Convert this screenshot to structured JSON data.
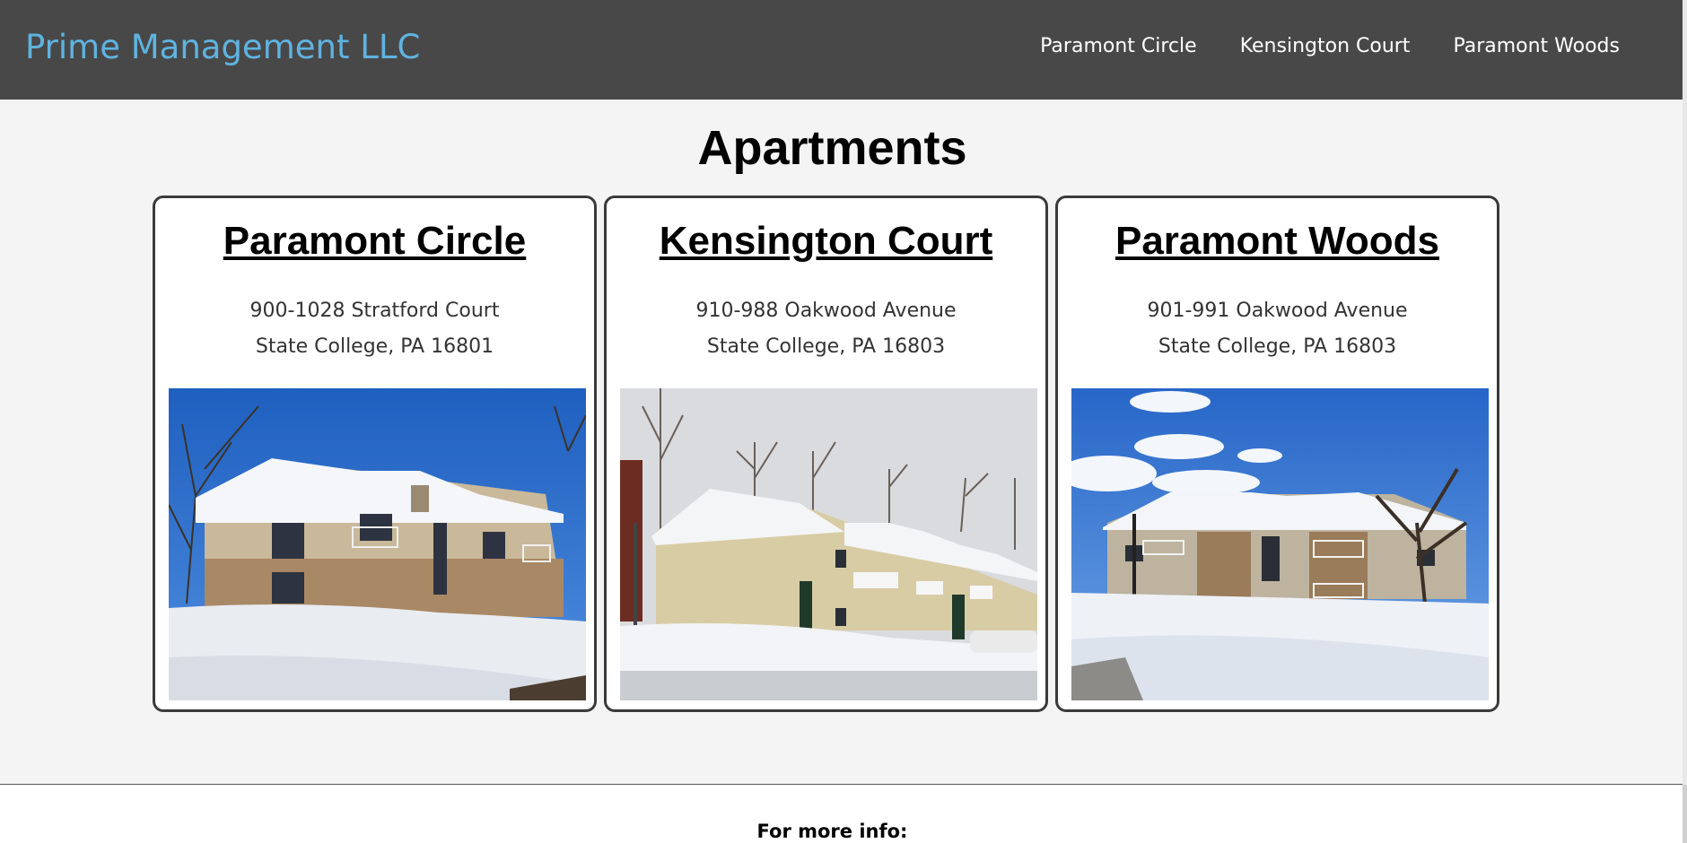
{
  "header": {
    "brand": "Prime Management LLC",
    "nav": [
      {
        "label": "Paramont Circle"
      },
      {
        "label": "Kensington Court"
      },
      {
        "label": "Paramont Woods"
      }
    ]
  },
  "main": {
    "title": "Apartments",
    "cards": [
      {
        "name": "Paramont Circle",
        "address_line1": "900-1028 Stratford Court",
        "address_line2": "State College, PA 16801"
      },
      {
        "name": "Kensington Court",
        "address_line1": "910-988 Oakwood Avenue",
        "address_line2": "State College, PA 16803"
      },
      {
        "name": "Paramont Woods",
        "address_line1": "901-991 Oakwood Avenue",
        "address_line2": "State College, PA 16803"
      }
    ]
  },
  "footer": {
    "label": "For more info:"
  },
  "colors": {
    "header_bg": "#484848",
    "brand": "#5fb3e0",
    "page_bg": "#f4f4f4",
    "card_border": "#3a3a3a"
  }
}
